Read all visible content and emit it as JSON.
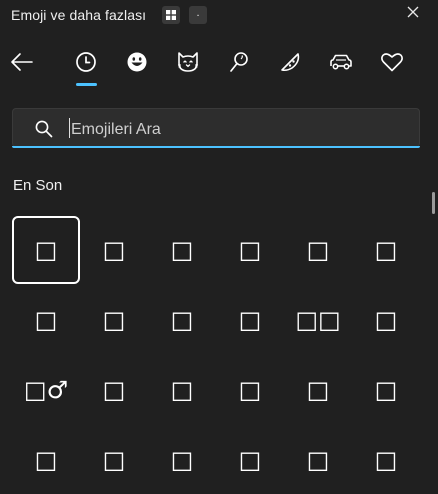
{
  "window": {
    "title": "Emoji ve daha fazlası",
    "close_label": "✕"
  },
  "shortcut_hint": {
    "win_key_icon": "windows-logo-icon",
    "period_key": "."
  },
  "tabs": [
    {
      "name": "back",
      "icon": "back-arrow-icon"
    },
    {
      "name": "recent",
      "icon": "clock-icon",
      "selected": true
    },
    {
      "name": "smileys",
      "icon": "smiley-icon"
    },
    {
      "name": "animals",
      "icon": "cat-face-icon"
    },
    {
      "name": "food",
      "icon": "lollipop-icon"
    },
    {
      "name": "pizza",
      "icon": "pizza-icon"
    },
    {
      "name": "travel",
      "icon": "car-icon"
    },
    {
      "name": "symbols",
      "icon": "heart-icon"
    }
  ],
  "accent_color": "#4cc2ff",
  "search": {
    "placeholder": "Emojileri Ara",
    "value": ""
  },
  "section": {
    "title": "En Son"
  },
  "emoji_rows": [
    [
      "□",
      "□",
      "□",
      "□",
      "□",
      "□"
    ],
    [
      "□",
      "□",
      "□",
      "□",
      "□□",
      "□"
    ],
    [
      "□♂",
      "□",
      "□",
      "□",
      "□",
      "□"
    ],
    [
      "□",
      "□",
      "□",
      "□",
      "□",
      "□"
    ]
  ]
}
